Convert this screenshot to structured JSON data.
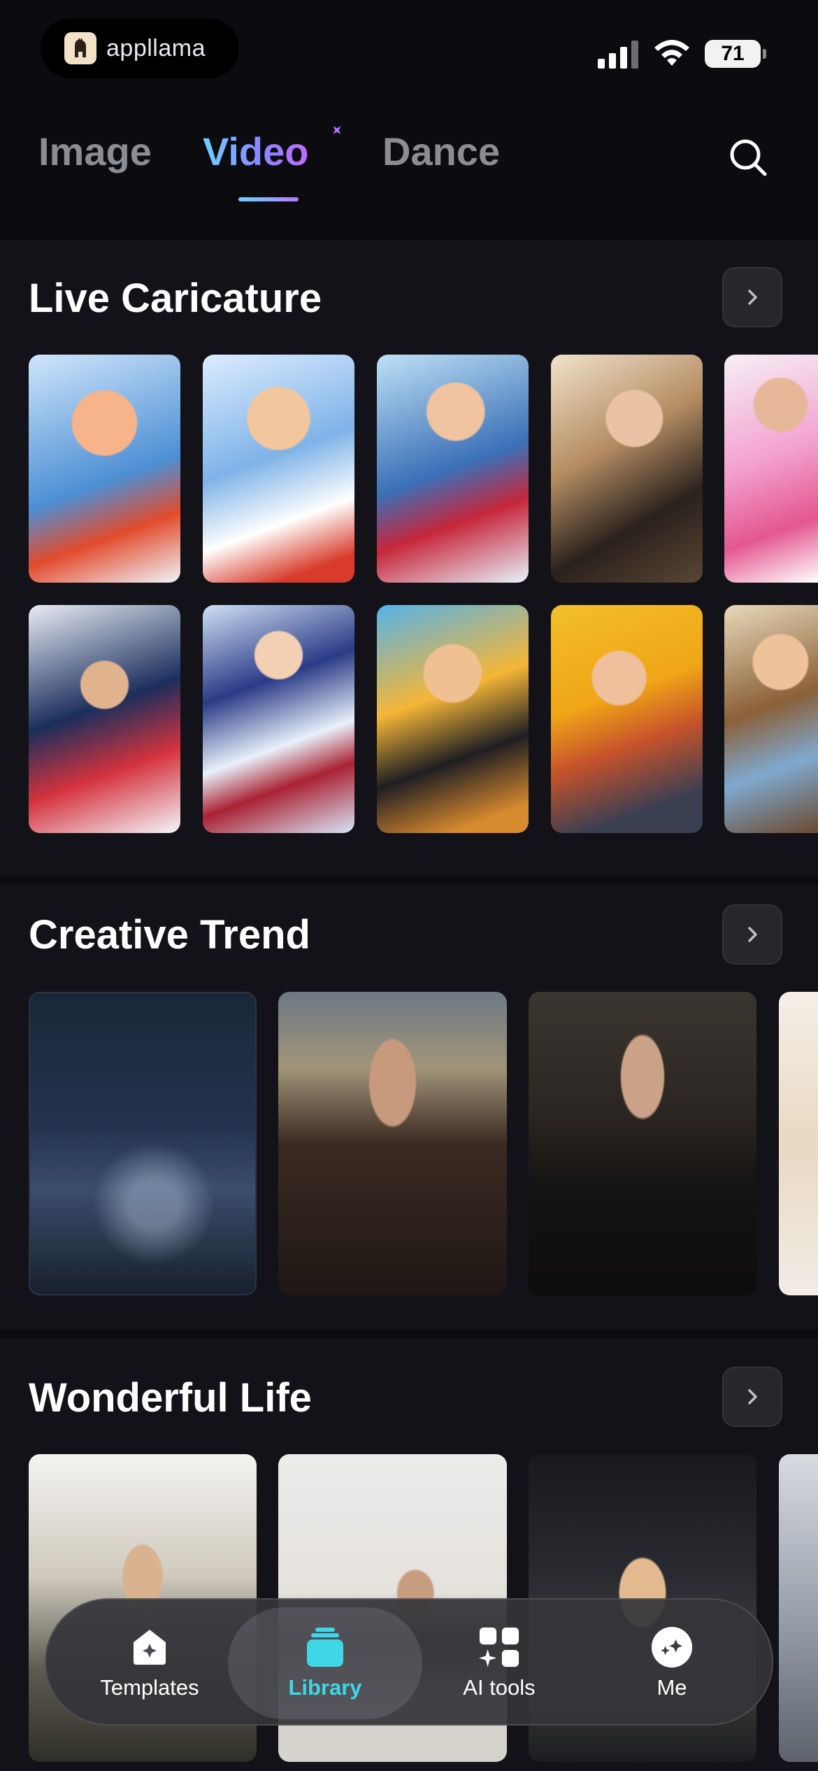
{
  "status_bar": {
    "app_name": "appllama",
    "battery": "71"
  },
  "tabs": [
    {
      "label": "Image",
      "active": false
    },
    {
      "label": "Video",
      "active": true
    },
    {
      "label": "Dance",
      "active": false
    }
  ],
  "sections": [
    {
      "title": "Live Caricature"
    },
    {
      "title": "Creative Trend"
    },
    {
      "title": "Wonderful Life"
    }
  ],
  "bottom_nav": [
    {
      "label": "Templates",
      "icon": "templates-icon",
      "active": false
    },
    {
      "label": "Library",
      "icon": "library-icon",
      "active": true
    },
    {
      "label": "AI tools",
      "icon": "ai-tools-icon",
      "active": false
    },
    {
      "label": "Me",
      "icon": "me-icon",
      "active": false
    }
  ],
  "colors": {
    "accent_gradient_start": "#6bd3ff",
    "accent_gradient_end": "#c06cff",
    "library_active": "#3fd7e8",
    "background": "#0b0b10",
    "section_background": "#121218"
  }
}
